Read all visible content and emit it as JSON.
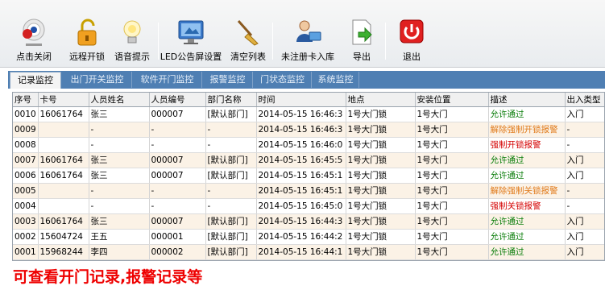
{
  "toolbar": {
    "items": [
      {
        "label": "点击关闭",
        "icon": "webcam-icon"
      },
      {
        "label": "远程开锁",
        "icon": "unlock-icon"
      },
      {
        "label": "语音提示",
        "icon": "lightbulb-icon"
      },
      {
        "label": "LED公告屏设置",
        "icon": "monitor-icon"
      },
      {
        "label": "清空列表",
        "icon": "broom-icon"
      },
      {
        "label": "未注册卡入库",
        "icon": "user-card-icon"
      },
      {
        "label": "导出",
        "icon": "export-icon"
      },
      {
        "label": "退出",
        "icon": "power-icon"
      }
    ]
  },
  "tabs": [
    {
      "label": "记录监控"
    },
    {
      "label": "出门开关监控"
    },
    {
      "label": "软件开门监控"
    },
    {
      "label": "报警监控"
    },
    {
      "label": "门状态监控"
    },
    {
      "label": "系统监控"
    }
  ],
  "table": {
    "headers": [
      "序号",
      "卡号",
      "人员姓名",
      "人员编号",
      "部门名称",
      "时间",
      "地点",
      "安装位置",
      "描述",
      "出入类型"
    ],
    "rows": [
      {
        "seq": "0010",
        "card": "16061764",
        "name": "张三",
        "no": "000007",
        "dept": "[默认部门]",
        "time": "2014-05-15 16:46:3",
        "loc": "1号大门锁",
        "pos": "1号大门",
        "desc": "允许通过",
        "type": "入门",
        "tone": "green"
      },
      {
        "seq": "0009",
        "card": "",
        "name": "-",
        "no": "-",
        "dept": "-",
        "time": "2014-05-15 16:46:3",
        "loc": "1号大门锁",
        "pos": "1号大门",
        "desc": "解除强制开锁报警",
        "type": "-",
        "tone": "orange"
      },
      {
        "seq": "0008",
        "card": "",
        "name": "-",
        "no": "-",
        "dept": "-",
        "time": "2014-05-15 16:46:0",
        "loc": "1号大门锁",
        "pos": "1号大门",
        "desc": "强制开锁报警",
        "type": "-",
        "tone": "red"
      },
      {
        "seq": "0007",
        "card": "16061764",
        "name": "张三",
        "no": "000007",
        "dept": "[默认部门]",
        "time": "2014-05-15 16:45:5",
        "loc": "1号大门锁",
        "pos": "1号大门",
        "desc": "允许通过",
        "type": "入门",
        "tone": "green"
      },
      {
        "seq": "0006",
        "card": "16061764",
        "name": "张三",
        "no": "000007",
        "dept": "[默认部门]",
        "time": "2014-05-15 16:45:1",
        "loc": "1号大门锁",
        "pos": "1号大门",
        "desc": "允许通过",
        "type": "入门",
        "tone": "green"
      },
      {
        "seq": "0005",
        "card": "",
        "name": "-",
        "no": "-",
        "dept": "-",
        "time": "2014-05-15 16:45:1",
        "loc": "1号大门锁",
        "pos": "1号大门",
        "desc": "解除强制关锁报警",
        "type": "-",
        "tone": "orange"
      },
      {
        "seq": "0004",
        "card": "",
        "name": "-",
        "no": "-",
        "dept": "-",
        "time": "2014-05-15 16:45:0",
        "loc": "1号大门锁",
        "pos": "1号大门",
        "desc": "强制关锁报警",
        "type": "-",
        "tone": "red"
      },
      {
        "seq": "0003",
        "card": "16061764",
        "name": "张三",
        "no": "000007",
        "dept": "[默认部门]",
        "time": "2014-05-15 16:44:3",
        "loc": "1号大门锁",
        "pos": "1号大门",
        "desc": "允许通过",
        "type": "入门",
        "tone": "green"
      },
      {
        "seq": "0002",
        "card": "15604724",
        "name": "王五",
        "no": "000001",
        "dept": "[默认部门]",
        "time": "2014-05-15 16:44:2",
        "loc": "1号大门锁",
        "pos": "1号大门",
        "desc": "允许通过",
        "type": "入门",
        "tone": "green"
      },
      {
        "seq": "0001",
        "card": "15968244",
        "name": "李四",
        "no": "000002",
        "dept": "[默认部门]",
        "time": "2014-05-15 16:44:1",
        "loc": "1号大门锁",
        "pos": "1号大门",
        "desc": "允许通过",
        "type": "入门",
        "tone": "green"
      }
    ]
  },
  "caption": "可查看开门记录,报警记录等"
}
